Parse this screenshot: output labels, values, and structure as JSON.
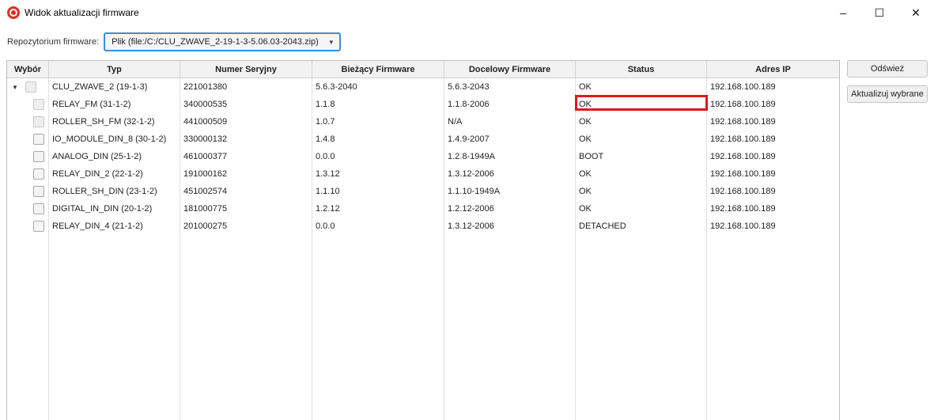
{
  "window": {
    "title": "Widok aktualizacji firmware",
    "controls": {
      "minimize": "–",
      "maximize": "☐",
      "close": "✕"
    }
  },
  "repository": {
    "label": "Repozytorium firmware:",
    "selected": "Plik (file:/C:/CLU_ZWAVE_2-19-1-3-5.06.03-2043.zip)"
  },
  "table": {
    "columns": [
      "Wybór",
      "Typ",
      "Numer Seryjny",
      "Bieżący Firmware",
      "Docelowy Firmware",
      "Status",
      "Adres IP"
    ],
    "rows": [
      {
        "type": "CLU_ZWAVE_2 (19-1-3)",
        "serial": "221001380",
        "current": "5.6.3-2040",
        "target": "5.6.3-2043",
        "status": "OK",
        "ip": "192.168.100.189"
      },
      {
        "type": "RELAY_FM (31-1-2)",
        "serial": "340000535",
        "current": "1.1.8",
        "target": "1.1.8-2006",
        "status": "OK",
        "ip": "192.168.100.189"
      },
      {
        "type": "ROLLER_SH_FM (32-1-2)",
        "serial": "441000509",
        "current": "1.0.7",
        "target": "N/A",
        "status": "OK",
        "ip": "192.168.100.189"
      },
      {
        "type": "IO_MODULE_DIN_8 (30-1-2)",
        "serial": "330000132",
        "current": "1.4.8",
        "target": "1.4.9-2007",
        "status": "OK",
        "ip": "192.168.100.189"
      },
      {
        "type": "ANALOG_DIN (25-1-2)",
        "serial": "461000377",
        "current": "0.0.0",
        "target": "1.2.8-1949A",
        "status": "BOOT",
        "ip": "192.168.100.189"
      },
      {
        "type": "RELAY_DIN_2 (22-1-2)",
        "serial": "191000162",
        "current": "1.3.12",
        "target": "1.3.12-2006",
        "status": "OK",
        "ip": "192.168.100.189"
      },
      {
        "type": "ROLLER_SH_DIN (23-1-2)",
        "serial": "451002574",
        "current": "1.1.10",
        "target": "1.1.10-1949A",
        "status": "OK",
        "ip": "192.168.100.189"
      },
      {
        "type": "DIGITAL_IN_DIN (20-1-2)",
        "serial": "181000775",
        "current": "1.2.12",
        "target": "1.2.12-2006",
        "status": "OK",
        "ip": "192.168.100.189"
      },
      {
        "type": "RELAY_DIN_4 (21-1-2)",
        "serial": "201000275",
        "current": "0.0.0",
        "target": "1.3.12-2006",
        "status": "DETACHED",
        "ip": "192.168.100.189"
      }
    ]
  },
  "buttons": {
    "refresh": "Odśwież",
    "update_selected": "Aktualizuj wybrane"
  },
  "colors": {
    "accent": "#3a8fd9",
    "highlight": "#e3141f",
    "app_icon": "#d93025"
  }
}
